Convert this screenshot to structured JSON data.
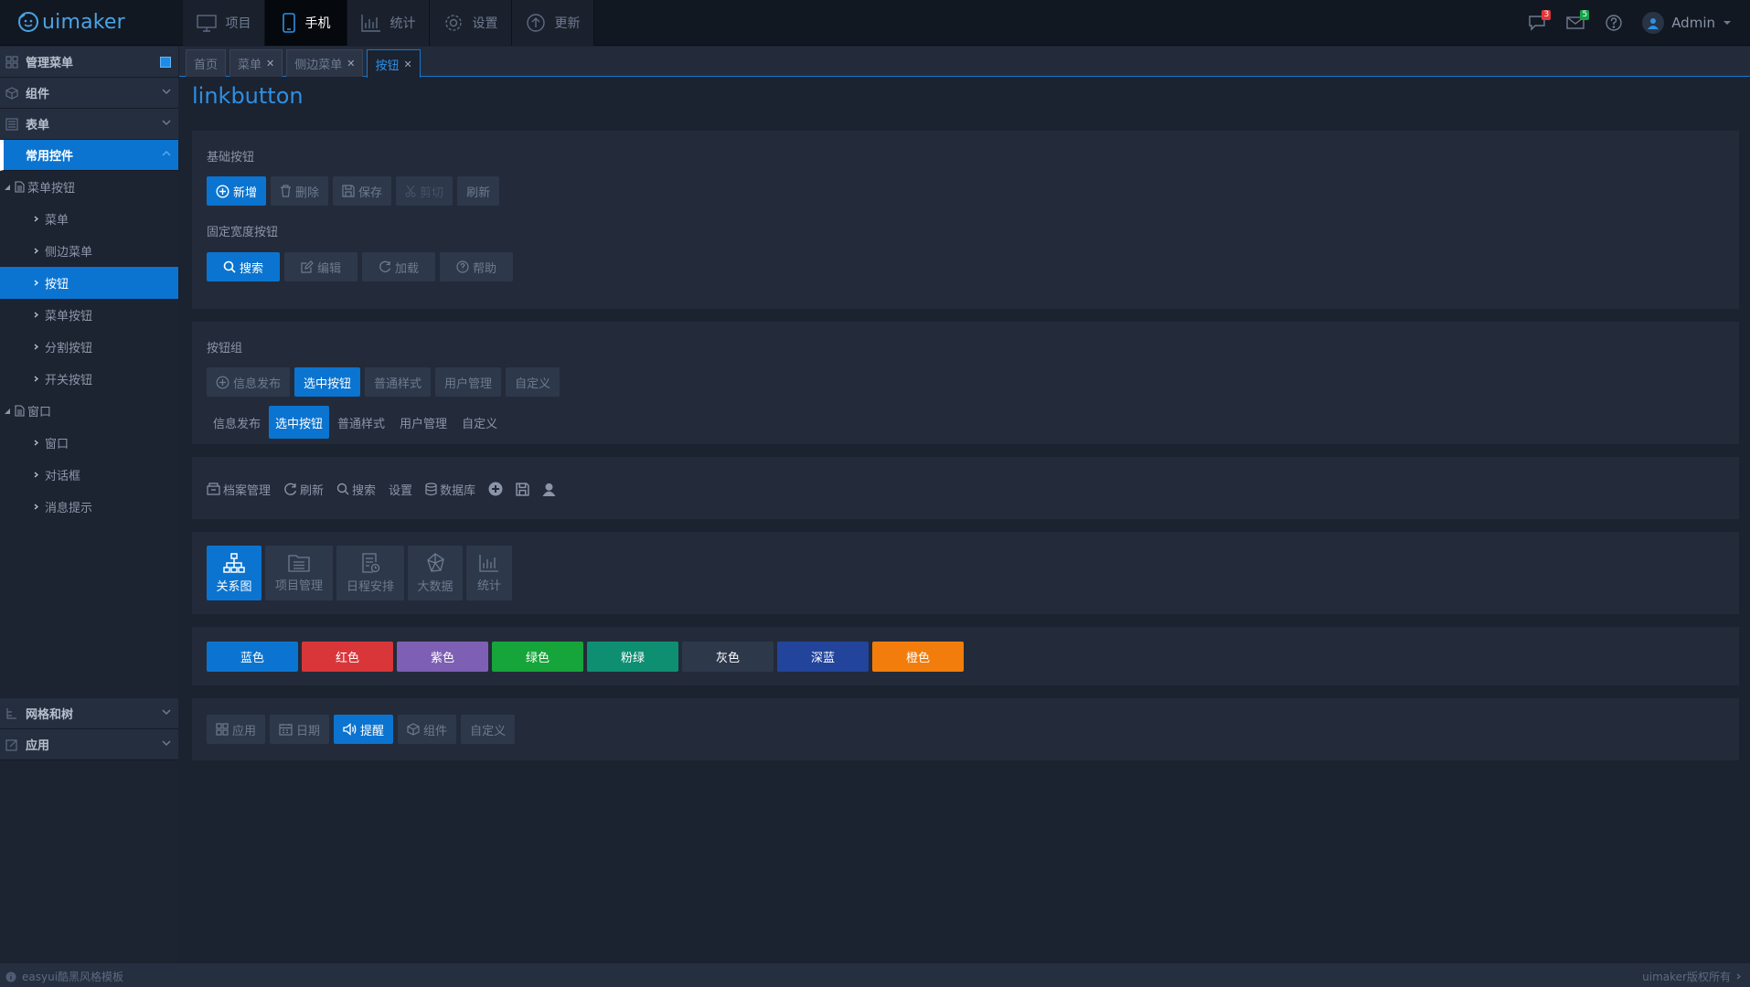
{
  "app": {
    "logo_text": "uimaker"
  },
  "topnav": [
    {
      "label": "项目",
      "icon": "monitor-icon"
    },
    {
      "label": "手机",
      "icon": "phone-icon",
      "active": true
    },
    {
      "label": "统计",
      "icon": "chart-icon"
    },
    {
      "label": "设置",
      "icon": "gear-icon"
    },
    {
      "label": "更新",
      "icon": "upload-icon"
    }
  ],
  "header_right": {
    "chat_badge": "3",
    "mail_badge": "5",
    "user": "Admin"
  },
  "sidebar": {
    "header": "管理菜单",
    "groups": [
      {
        "label": "组件"
      },
      {
        "label": "表单"
      },
      {
        "label": "常用控件"
      }
    ],
    "tree": [
      {
        "label": "菜单按钮",
        "children": [
          "菜单",
          "侧边菜单",
          "按钮",
          "菜单按钮",
          "分割按钮",
          "开关按钮"
        ]
      },
      {
        "label": "窗口",
        "children": [
          "窗口",
          "对话框",
          "消息提示"
        ]
      }
    ],
    "bottom_groups": [
      {
        "label": "网格和树"
      },
      {
        "label": "应用"
      }
    ]
  },
  "tabs": [
    {
      "label": "首页",
      "closable": false
    },
    {
      "label": "菜单",
      "closable": true
    },
    {
      "label": "侧边菜单",
      "closable": true
    },
    {
      "label": "按钮",
      "closable": true,
      "active": true
    }
  ],
  "page_title": "linkbutton",
  "basic": {
    "label": "基础按钮",
    "buttons": [
      "新增",
      "删除",
      "保存",
      "剪切",
      "刷新"
    ],
    "fixed_label": "固定宽度按钮",
    "fixed_buttons": [
      "搜索",
      "编辑",
      "加载",
      "帮助"
    ]
  },
  "group": {
    "label": "按钮组",
    "buttons": [
      "信息发布",
      "选中按钮",
      "普通样式",
      "用户管理",
      "自定义"
    ],
    "plain_buttons": [
      "信息发布",
      "选中按钮",
      "普通样式",
      "用户管理",
      "自定义"
    ]
  },
  "toolbar": {
    "buttons": [
      "档案管理",
      "刷新",
      "搜索",
      "设置",
      "数据库"
    ]
  },
  "big_buttons": [
    "关系图",
    "项目管理",
    "日程安排",
    "大数据",
    "统计"
  ],
  "color_buttons": [
    {
      "label": "蓝色",
      "color": "#0b74d0"
    },
    {
      "label": "红色",
      "color": "#d9363a"
    },
    {
      "label": "紫色",
      "color": "#7d5fb3"
    },
    {
      "label": "绿色",
      "color": "#16a53a"
    },
    {
      "label": "粉绿",
      "color": "#0e8f72"
    },
    {
      "label": "灰色",
      "color": "#2e384b"
    },
    {
      "label": "深蓝",
      "color": "#22449a"
    },
    {
      "label": "橙色",
      "color": "#f27d0c"
    }
  ],
  "icon_buttons": [
    "应用",
    "日期",
    "提醒",
    "组件",
    "自定义"
  ],
  "footer": {
    "left": "easyui酷黑风格模板",
    "right": "uimaker版权所有"
  }
}
